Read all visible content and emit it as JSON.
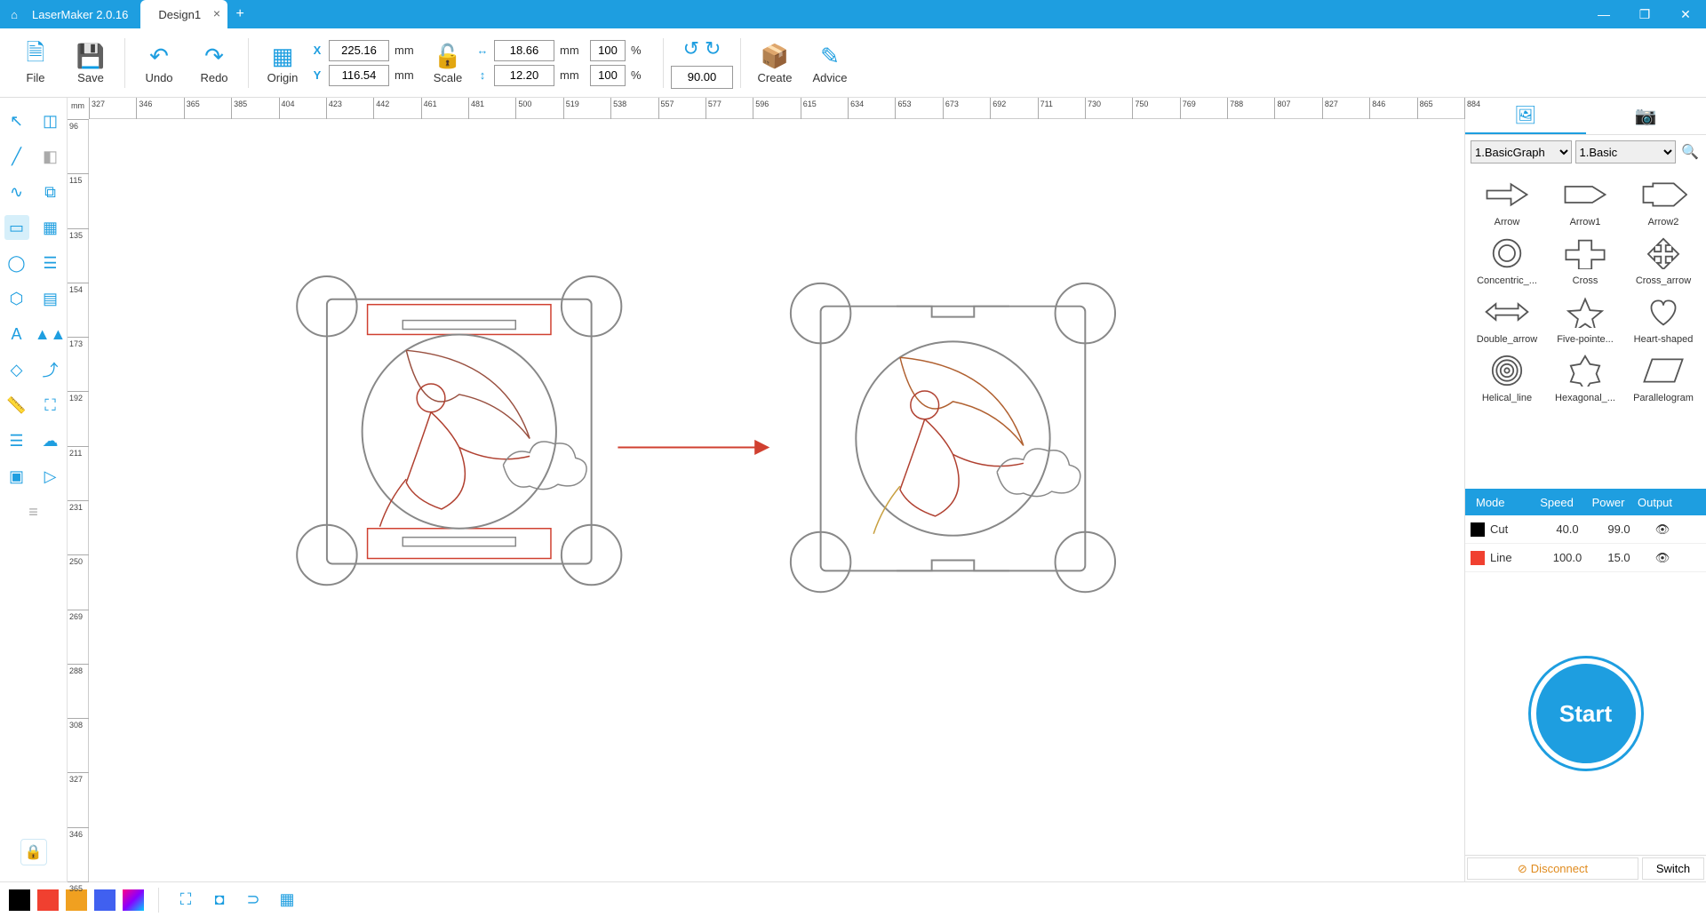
{
  "app": {
    "title": "LaserMaker 2.0.16",
    "tab_name": "Design1"
  },
  "toolbar": {
    "file": "File",
    "save": "Save",
    "undo": "Undo",
    "redo": "Redo",
    "origin": "Origin",
    "x_label": "X",
    "y_label": "Y",
    "x_value": "225.16",
    "y_value": "116.54",
    "pos_unit": "mm",
    "scale": "Scale",
    "w_value": "18.66",
    "h_value": "12.20",
    "size_unit": "mm",
    "w_pct": "100",
    "h_pct": "100",
    "pct_unit": "%",
    "rotate_value": "90.00",
    "create": "Create",
    "advice": "Advice"
  },
  "ruler": {
    "unit": "mm",
    "h_ticks": [
      "327",
      "346",
      "365",
      "385",
      "404",
      "423",
      "442",
      "461",
      "481",
      "500",
      "519",
      "538",
      "557",
      "577",
      "596",
      "615",
      "634",
      "653",
      "673",
      "692",
      "711",
      "730",
      "750",
      "769",
      "788",
      "807",
      "827",
      "846",
      "865",
      "884"
    ],
    "v_ticks": [
      "96",
      "115",
      "135",
      "154",
      "173",
      "192",
      "211",
      "231",
      "250",
      "269",
      "288",
      "308",
      "327",
      "346",
      "365"
    ]
  },
  "right_panel": {
    "filter1": "1.BasicGraph",
    "filter2": "1.Basic",
    "shapes": [
      {
        "name": "Arrow"
      },
      {
        "name": "Arrow1"
      },
      {
        "name": "Arrow2"
      },
      {
        "name": "Concentric_..."
      },
      {
        "name": "Cross"
      },
      {
        "name": "Cross_arrow"
      },
      {
        "name": "Double_arrow"
      },
      {
        "name": "Five-pointe..."
      },
      {
        "name": "Heart-shaped"
      },
      {
        "name": "Helical_line"
      },
      {
        "name": "Hexagonal_..."
      },
      {
        "name": "Parallelogram"
      }
    ],
    "layers_header": {
      "mode": "Mode",
      "speed": "Speed",
      "power": "Power",
      "output": "Output"
    },
    "layers": [
      {
        "color": "#000000",
        "mode": "Cut",
        "speed": "40.0",
        "power": "99.0"
      },
      {
        "color": "#f04030",
        "mode": "Line",
        "speed": "100.0",
        "power": "15.0"
      }
    ],
    "start": "Start",
    "disconnect": "Disconnect",
    "switch": "Switch"
  },
  "bottom_colors": [
    "#000000",
    "#f04030",
    "#f0a020",
    "#4060f0",
    "#c070e0"
  ]
}
